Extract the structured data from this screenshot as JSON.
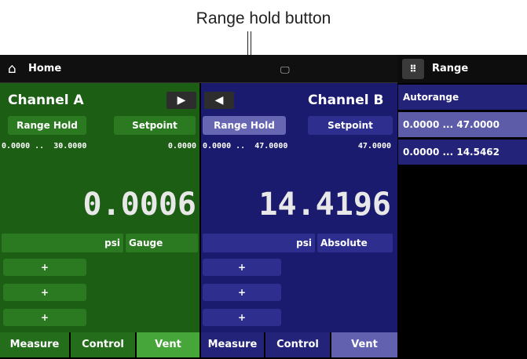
{
  "callout": {
    "label": "Range hold button"
  },
  "topbar": {
    "home_icon": "home-icon",
    "home_label": "Home",
    "system_icon": "display-network-icon"
  },
  "range_panel": {
    "title": "Range",
    "grid_icon": "grid-icon",
    "items": [
      "Autorange",
      "0.0000 ... 47.0000",
      "0.0000 ... 14.5462"
    ],
    "selected_index": 1
  },
  "channel_a": {
    "title": "Channel A",
    "nav_icon": "arrow-right-icon",
    "range_hold_label": "Range Hold",
    "setpoint_label": "Setpoint",
    "range_text": "0.0000 ..  30.0000",
    "setpoint_value": "0.0000",
    "reading": "0.0006",
    "unit": "psi",
    "mode": "Gauge",
    "plus_labels": [
      "+",
      "+",
      "+"
    ],
    "tabs": [
      "Measure",
      "Control",
      "Vent"
    ],
    "active_tab": "Vent"
  },
  "channel_b": {
    "title": "Channel B",
    "nav_icon": "arrow-left-icon",
    "range_hold_label": "Range Hold",
    "setpoint_label": "Setpoint",
    "range_text": "0.0000 ..  47.0000",
    "setpoint_value": "47.0000",
    "reading": "14.4196",
    "unit": "psi",
    "mode": "Absolute",
    "plus_labels": [
      "+",
      "+",
      "+"
    ],
    "tabs": [
      "Measure",
      "Control",
      "Vent"
    ],
    "active_tab": "Vent"
  },
  "colors": {
    "channel_a_bg": "#1b5e14",
    "channel_b_bg": "#1a1a6e",
    "range_selected": "#5c5ca8",
    "range_normal": "#23237a"
  }
}
